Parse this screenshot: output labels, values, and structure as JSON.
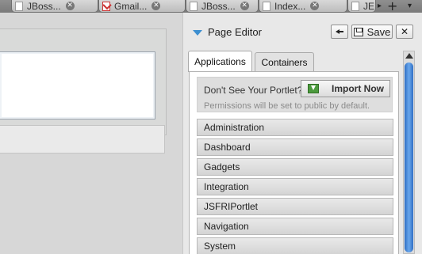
{
  "browser": {
    "tabs": [
      {
        "title": "JBoss...",
        "icon": "page-icon"
      },
      {
        "title": "Gmail...",
        "icon": "gmail-icon"
      },
      {
        "title": "JBoss...",
        "icon": "page-icon"
      },
      {
        "title": "Index...",
        "icon": "page-icon"
      },
      {
        "title": "JE",
        "icon": "page-icon"
      }
    ],
    "close_glyph": "✕",
    "scroll_glyph": "▸",
    "new_tab_glyph": "+",
    "list_glyph": "▾"
  },
  "editor": {
    "title": "Page Editor",
    "save_label": "Save",
    "close_glyph": "✕",
    "tabs": {
      "applications": "Applications",
      "containers": "Containers"
    },
    "import": {
      "question": "Don't See Your Portlet?",
      "button_label": "Import Now",
      "note": "Permissions will be set to public by default."
    },
    "categories": [
      "Administration",
      "Dashboard",
      "Gadgets",
      "Integration",
      "JSFRIPortlet",
      "Navigation",
      "System"
    ],
    "accent_color": "#3d8fd0"
  }
}
